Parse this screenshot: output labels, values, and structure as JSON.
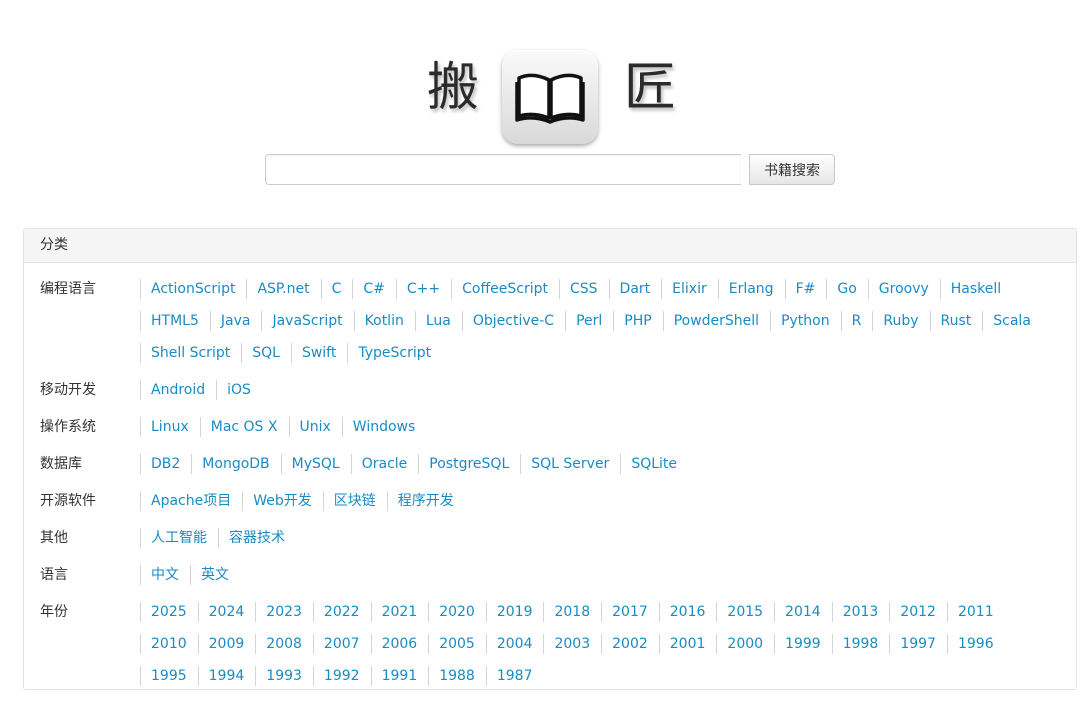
{
  "logo": {
    "left_char": "搬",
    "right_char": "匠",
    "icon": "book-icon"
  },
  "search": {
    "value": "",
    "placeholder": "",
    "button_label": "书籍搜索"
  },
  "panel": {
    "title": "分类",
    "categories": [
      {
        "label": "编程语言",
        "links": [
          "ActionScript",
          "ASP.net",
          "C",
          "C#",
          "C++",
          "CoffeeScript",
          "CSS",
          "Dart",
          "Elixir",
          "Erlang",
          "F#",
          "Go",
          "Groovy",
          "Haskell",
          "HTML5",
          "Java",
          "JavaScript",
          "Kotlin",
          "Lua",
          "Objective-C",
          "Perl",
          "PHP",
          "PowderShell",
          "Python",
          "R",
          "Ruby",
          "Rust",
          "Scala",
          "Shell Script",
          "SQL",
          "Swift",
          "TypeScript"
        ]
      },
      {
        "label": "移动开发",
        "links": [
          "Android",
          "iOS"
        ]
      },
      {
        "label": "操作系统",
        "links": [
          "Linux",
          "Mac OS X",
          "Unix",
          "Windows"
        ]
      },
      {
        "label": "数据库",
        "links": [
          "DB2",
          "MongoDB",
          "MySQL",
          "Oracle",
          "PostgreSQL",
          "SQL Server",
          "SQLite"
        ]
      },
      {
        "label": "开源软件",
        "links": [
          "Apache项目",
          "Web开发",
          "区块链",
          "程序开发"
        ]
      },
      {
        "label": "其他",
        "links": [
          "人工智能",
          "容器技术"
        ]
      },
      {
        "label": "语言",
        "links": [
          "中文",
          "英文"
        ]
      },
      {
        "label": "年份",
        "links": [
          "2025",
          "2024",
          "2023",
          "2022",
          "2021",
          "2020",
          "2019",
          "2018",
          "2017",
          "2016",
          "2015",
          "2014",
          "2013",
          "2012",
          "2011",
          "2010",
          "2009",
          "2008",
          "2007",
          "2006",
          "2005",
          "2004",
          "2003",
          "2002",
          "2001",
          "2000",
          "1999",
          "1998",
          "1997",
          "1996",
          "1995",
          "1994",
          "1993",
          "1992",
          "1991",
          "1988",
          "1987"
        ]
      }
    ]
  },
  "colors": {
    "link": "#1a8bc4",
    "divider": "#d5d5d5",
    "panel_header_bg": "#f5f5f5"
  }
}
